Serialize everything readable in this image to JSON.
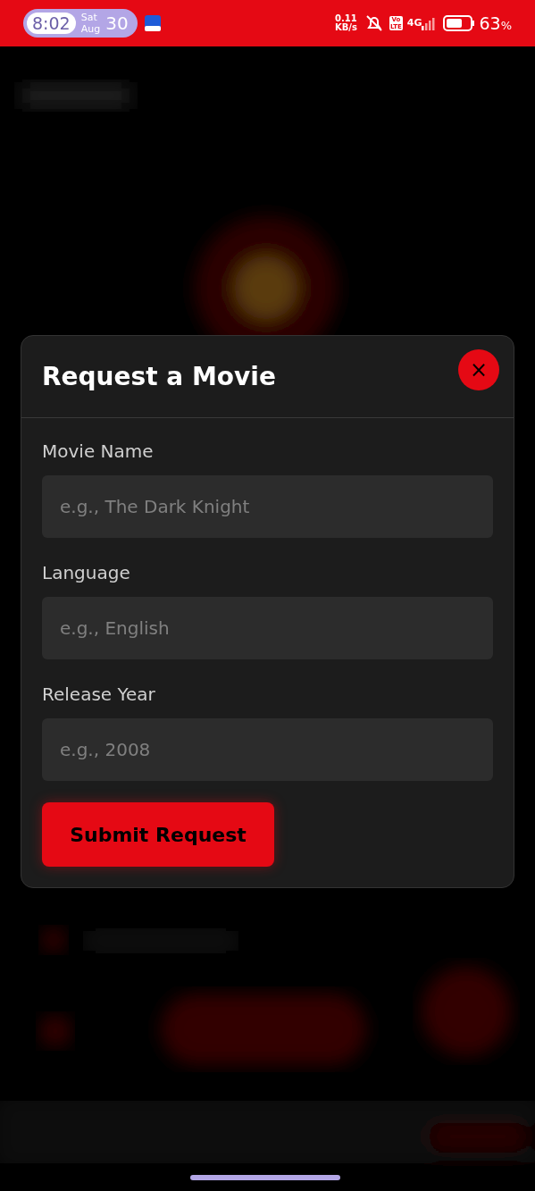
{
  "status_bar": {
    "time": "8:02",
    "day": "Sat",
    "month": "Aug",
    "date": "30",
    "speed": "0.11",
    "speed_unit": "KB/s",
    "volte_top": "Vo",
    "volte_bottom": "LTE",
    "network": "4G",
    "battery": "63",
    "battery_unit": "%"
  },
  "modal": {
    "title": "Request a Movie",
    "close": "×",
    "fields": [
      {
        "label": "Movie Name",
        "placeholder": "e.g., The Dark Knight"
      },
      {
        "label": "Language",
        "placeholder": "e.g., English"
      },
      {
        "label": "Release Year",
        "placeholder": "e.g., 2008"
      }
    ],
    "submit": "Submit Request"
  }
}
